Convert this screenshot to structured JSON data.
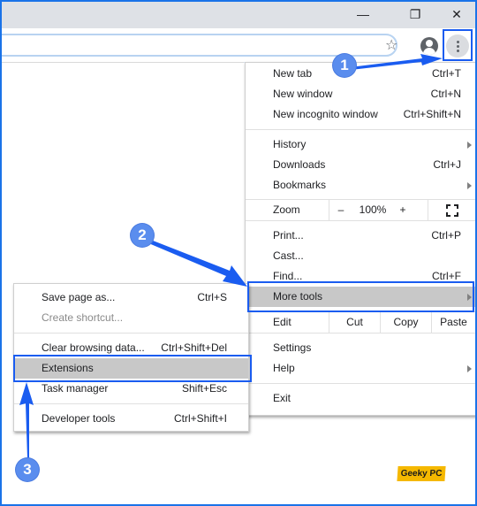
{
  "window": {
    "controls": [
      {
        "name": "minimize",
        "glyph": "—"
      },
      {
        "name": "restore",
        "glyph": "❐"
      },
      {
        "name": "close",
        "glyph": "✕"
      }
    ]
  },
  "toolbar": {
    "omnibox_value": "",
    "bookmark_icon": "☆",
    "profile_icon": "avatar",
    "menu_icon": "kebab"
  },
  "main_menu": {
    "group1": [
      {
        "label": "New tab",
        "shortcut": "Ctrl+T"
      },
      {
        "label": "New window",
        "shortcut": "Ctrl+N"
      },
      {
        "label": "New incognito window",
        "shortcut": "Ctrl+Shift+N"
      }
    ],
    "group2": [
      {
        "label": "History",
        "shortcut": "",
        "submenu": true
      },
      {
        "label": "Downloads",
        "shortcut": "Ctrl+J"
      },
      {
        "label": "Bookmarks",
        "shortcut": "",
        "submenu": true
      }
    ],
    "zoom": {
      "label": "Zoom",
      "minus": "–",
      "value": "100%",
      "plus": "+",
      "fullscreen_icon": "fullscreen"
    },
    "group3": [
      {
        "label": "Print...",
        "shortcut": "Ctrl+P"
      },
      {
        "label": "Cast...",
        "shortcut": ""
      },
      {
        "label": "Find...",
        "shortcut": "Ctrl+F"
      },
      {
        "label": "More tools",
        "shortcut": "",
        "submenu": true,
        "highlighted": true
      }
    ],
    "edit": {
      "label": "Edit",
      "cut": "Cut",
      "copy": "Copy",
      "paste": "Paste"
    },
    "group4": [
      {
        "label": "Settings",
        "shortcut": ""
      },
      {
        "label": "Help",
        "shortcut": "",
        "submenu": true
      }
    ],
    "group5": [
      {
        "label": "Exit",
        "shortcut": ""
      }
    ]
  },
  "more_tools_menu": {
    "group1": [
      {
        "label": "Save page as...",
        "shortcut": "Ctrl+S"
      },
      {
        "label": "Create shortcut...",
        "shortcut": "",
        "disabled": true
      }
    ],
    "group2": [
      {
        "label": "Clear browsing data...",
        "shortcut": "Ctrl+Shift+Del"
      },
      {
        "label": "Extensions",
        "shortcut": "",
        "highlighted": true
      },
      {
        "label": "Task manager",
        "shortcut": "Shift+Esc"
      }
    ],
    "group3": [
      {
        "label": "Developer tools",
        "shortcut": "Ctrl+Shift+I"
      }
    ]
  },
  "annotations": {
    "step1": "1",
    "step2": "2",
    "step3": "3",
    "accent_color": "#1a5cf0",
    "badge_color": "#5a8dee"
  },
  "watermark": "Geeky PC"
}
